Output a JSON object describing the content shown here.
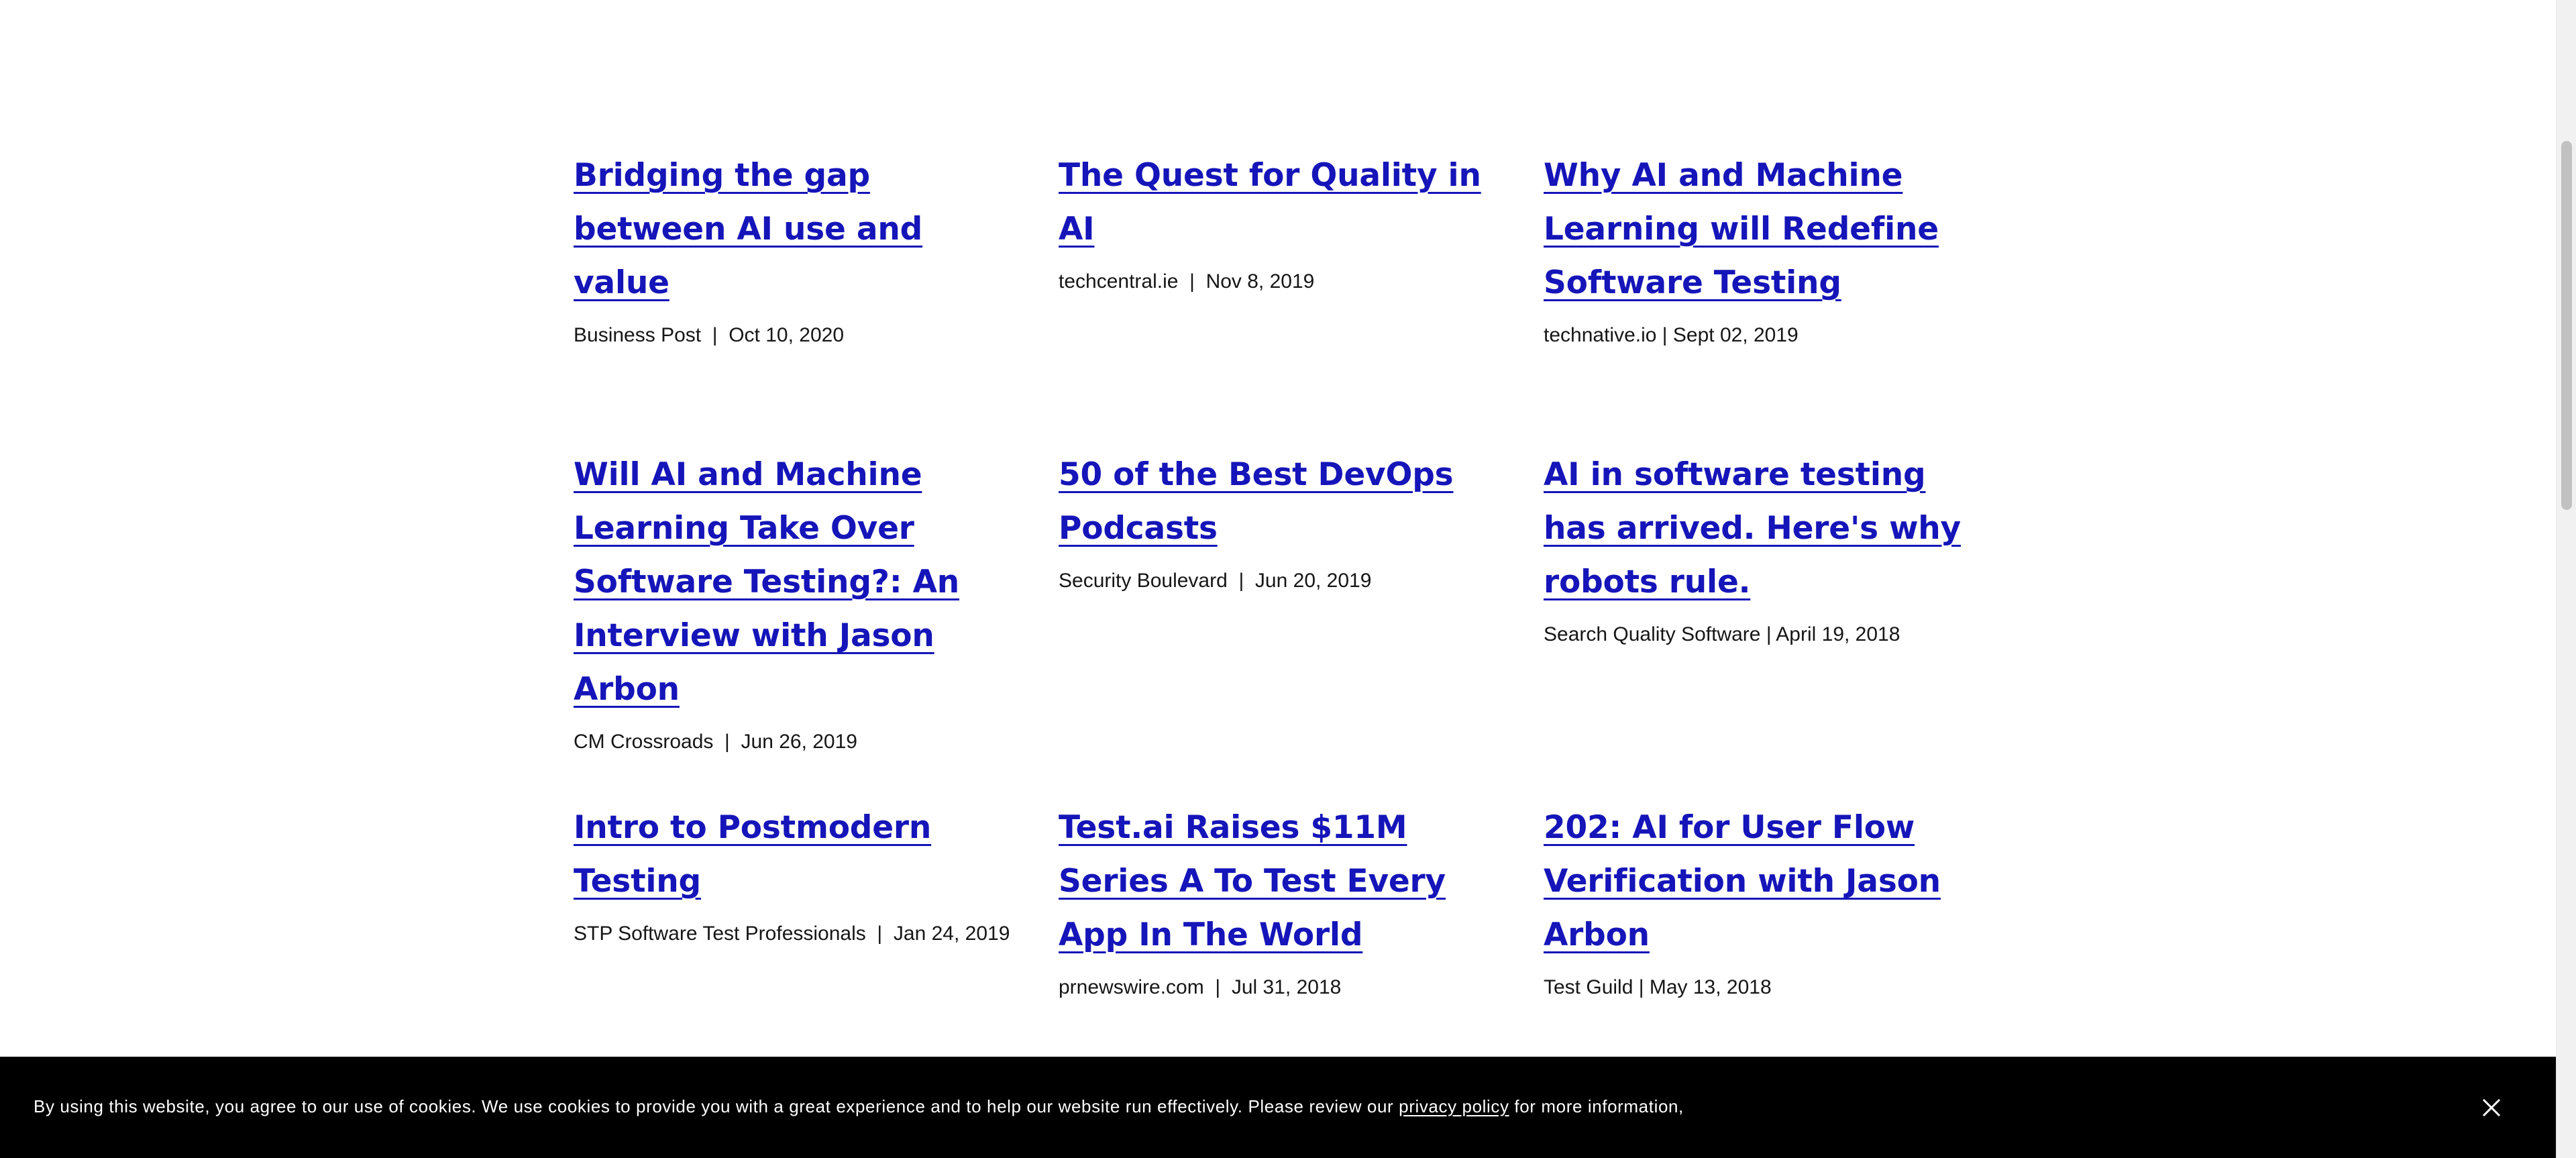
{
  "articles": [
    {
      "title": "Bridging the gap between AI use and value",
      "meta": "Business Post  |  Oct 10, 2020"
    },
    {
      "title": "The Quest for Quality in AI",
      "meta": "techcentral.ie  |  Nov 8, 2019"
    },
    {
      "title": "Why AI and Machine Learning will Redefine Software Testing",
      "meta": "technative.io | Sept 02, 2019"
    },
    {
      "title": "Will AI and Machine Learning Take Over Software Testing?: An Interview with Jason Arbon",
      "meta": "CM Crossroads  |  Jun 26, 2019"
    },
    {
      "title": "50 of the Best DevOps Podcasts",
      "meta": "Security Boulevard  |  Jun 20, 2019"
    },
    {
      "title": "AI in software testing has arrived. Here's why robots rule.",
      "meta": "Search Quality Software | April 19, 2018"
    },
    {
      "title": "Intro to Postmodern Testing",
      "meta": "STP Software Test Professionals  |  Jan 24, 2019"
    },
    {
      "title": "Test.ai Raises $11M Series A To Test Every App In The World",
      "meta": "prnewswire.com  |  Jul 31, 2018"
    },
    {
      "title": "202: AI for User Flow Verification with Jason Arbon",
      "meta": "Test Guild | May 13, 2018"
    }
  ],
  "cookie": {
    "text_before": "By using this website, you agree to our use of cookies. We use cookies to provide you with a great experience and to help our website run effectively. Please review our ",
    "link_text": "privacy policy",
    "text_after": " for more information,",
    "close_icon": "close-icon"
  },
  "colors": {
    "link": "#1515b9",
    "banner_bg": "#000000",
    "banner_text": "#ffffff"
  }
}
